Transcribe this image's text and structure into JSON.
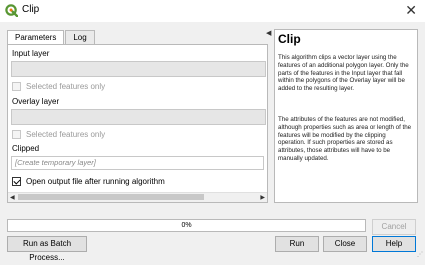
{
  "window": {
    "title": "Clip",
    "close_label": "✕"
  },
  "tabs": [
    {
      "label": "Parameters",
      "active": true
    },
    {
      "label": "Log",
      "active": false
    }
  ],
  "params": {
    "input_label": "Input layer",
    "input_value": "",
    "input_selected_label": "Selected features only",
    "overlay_label": "Overlay layer",
    "overlay_value": "",
    "overlay_selected_label": "Selected features only",
    "output_label": "Clipped",
    "output_placeholder": "[Create temporary layer]",
    "open_output_label": "Open output file after running algorithm",
    "open_output_checked": true
  },
  "help": {
    "title": "Clip",
    "p1": "This algorithm clips a vector layer using the features of an additional polygon layer. Only the parts of the features in the Input layer that fall within the polygons of the Overlay layer will be added to the resulting layer.",
    "p2": "The attributes of the features are not modified, although properties such as area or length of the features will be modified by the clipping operation. If such properties are stored as attributes, those attributes will have to be manually updated."
  },
  "progress": {
    "value": 0,
    "text": "0%"
  },
  "buttons": {
    "cancel": "Cancel",
    "batch": "Run as Batch Process...",
    "run": "Run",
    "close": "Close",
    "help": "Help"
  },
  "icons": {
    "app": "qgis-icon",
    "collapse": "collapse-left-arrow-icon"
  },
  "colors": {
    "accent": "#0078d7",
    "qgis_green": "#589632",
    "qgis_yellow": "#ee7913"
  }
}
